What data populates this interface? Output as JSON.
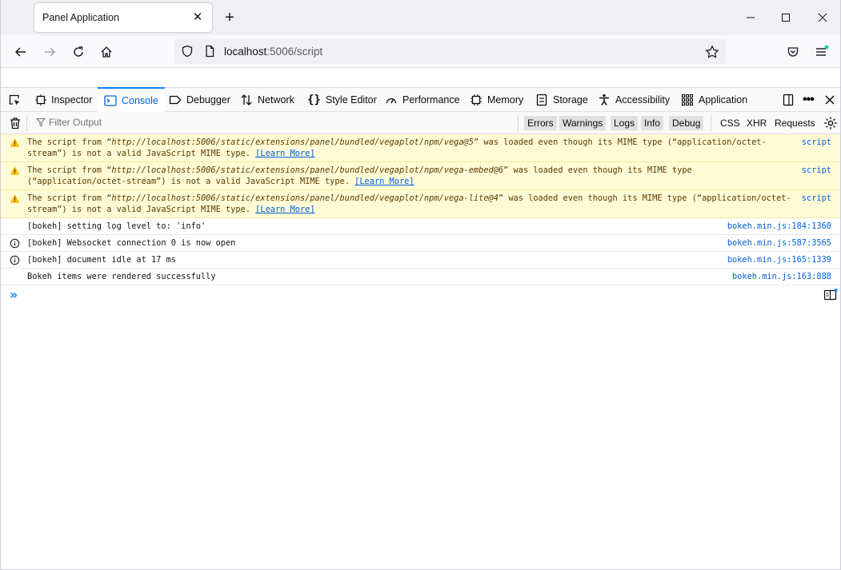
{
  "browser": {
    "tab_title": "Panel Application",
    "url_host": "localhost",
    "url_rest": ":5006/script"
  },
  "devtools": {
    "tabs": [
      {
        "label": "Inspector",
        "icon": "inspector-icon"
      },
      {
        "label": "Console",
        "icon": "console-icon",
        "active": true
      },
      {
        "label": "Debugger",
        "icon": "debugger-icon"
      },
      {
        "label": "Network",
        "icon": "network-icon"
      },
      {
        "label": "Style Editor",
        "icon": "style-editor-icon"
      },
      {
        "label": "Performance",
        "icon": "performance-icon"
      },
      {
        "label": "Memory",
        "icon": "memory-icon"
      },
      {
        "label": "Storage",
        "icon": "storage-icon"
      },
      {
        "label": "Accessibility",
        "icon": "accessibility-icon"
      },
      {
        "label": "Application",
        "icon": "application-icon"
      }
    ]
  },
  "console": {
    "filter_placeholder": "Filter Output",
    "filters": [
      "Errors",
      "Warnings",
      "Logs",
      "Info",
      "Debug"
    ],
    "extra_filters": [
      "CSS",
      "XHR",
      "Requests"
    ],
    "messages": [
      {
        "type": "warning",
        "pre": "The script from “",
        "url": "http://localhost:5006/static/extensions/panel/bundled/vegaplot/npm/vega@5",
        "post": "” was loaded even though its MIME type (“application/octet-stream”) is not a valid JavaScript MIME type. ",
        "learn": "[Learn More]",
        "source": "script"
      },
      {
        "type": "warning",
        "pre": "The script from “",
        "url": "http://localhost:5006/static/extensions/panel/bundled/vegaplot/npm/vega-embed@6",
        "post": "” was loaded even though its MIME type (“application/octet-stream”) is not a valid JavaScript MIME type. ",
        "learn": "[Learn More]",
        "source": "script"
      },
      {
        "type": "warning",
        "pre": "The script from “",
        "url": "http://localhost:5006/static/extensions/panel/bundled/vegaplot/npm/vega-lite@4",
        "post": "” was loaded even though its MIME type (“application/octet-stream”) is not a valid JavaScript MIME type. ",
        "learn": "[Learn More]",
        "source": "script"
      },
      {
        "type": "log",
        "text": "[bokeh] setting log level to: 'info'",
        "source": "bokeh.min.js:184:1360"
      },
      {
        "type": "info",
        "text": "[bokeh] Websocket connection 0 is now open",
        "source": "bokeh.min.js:587:3565"
      },
      {
        "type": "info",
        "text": "[bokeh] document idle at 17 ms",
        "source": "bokeh.min.js:165:1339"
      },
      {
        "type": "log",
        "text": "Bokeh items were rendered successfully",
        "source": "bokeh.min.js:163:888"
      }
    ]
  }
}
